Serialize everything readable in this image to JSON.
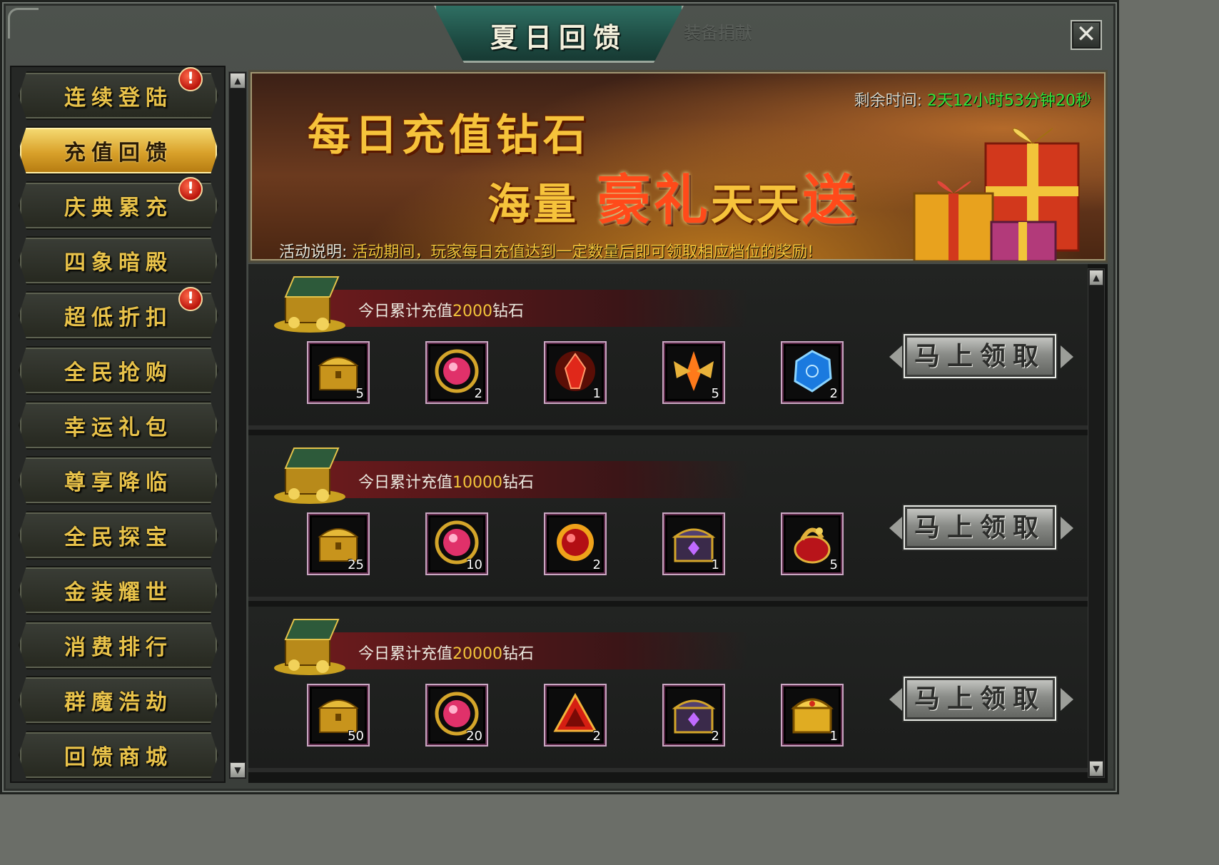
{
  "window": {
    "title": "夏日回馈",
    "inactive_tab": "装备捐献",
    "close_label": "✕"
  },
  "sidebar": {
    "items": [
      {
        "label": "连续登陆",
        "badge": "!"
      },
      {
        "label": "充值回馈",
        "active": true
      },
      {
        "label": "庆典累充",
        "badge": "!"
      },
      {
        "label": "四象暗殿"
      },
      {
        "label": "超低折扣",
        "badge": "!"
      },
      {
        "label": "全民抢购"
      },
      {
        "label": "幸运礼包"
      },
      {
        "label": "尊享降临"
      },
      {
        "label": "全民探宝"
      },
      {
        "label": "金装耀世"
      },
      {
        "label": "消费排行"
      },
      {
        "label": "群魔浩劫"
      },
      {
        "label": "回馈商城"
      }
    ]
  },
  "banner": {
    "timer_label": "剩余时间:",
    "timer_value": "2天12小时53分钟20秒",
    "headline_line1": "每日充值钻石",
    "headline_line2_a": "海量",
    "headline_line2_b": "豪礼",
    "headline_line2_c": "天天",
    "headline_line2_d": "送",
    "desc_label": "活动说明:",
    "desc_text": "活动期间，玩家每日充值达到一定数量后即可领取相应档位的奖励!"
  },
  "rewards": [
    {
      "prefix": "今日累计充值",
      "amount": "2000",
      "suffix": "钻石",
      "claim_label": "马上领取",
      "items": [
        {
          "icon": "gold-chest-icon",
          "qty": "5"
        },
        {
          "icon": "pink-gem-icon",
          "qty": "2"
        },
        {
          "icon": "red-crystal-icon",
          "qty": "1"
        },
        {
          "icon": "flame-wings-icon",
          "qty": "5"
        },
        {
          "icon": "blue-stone-icon",
          "qty": "2"
        }
      ]
    },
    {
      "prefix": "今日累计充值",
      "amount": "10000",
      "suffix": "钻石",
      "claim_label": "马上领取",
      "items": [
        {
          "icon": "gold-chest-icon",
          "qty": "25"
        },
        {
          "icon": "pink-gem-icon",
          "qty": "10"
        },
        {
          "icon": "red-orb-icon",
          "qty": "2"
        },
        {
          "icon": "jewel-chest-icon",
          "qty": "1"
        },
        {
          "icon": "dragon-urn-icon",
          "qty": "5"
        }
      ]
    },
    {
      "prefix": "今日累计充值",
      "amount": "20000",
      "suffix": "钻石",
      "claim_label": "马上领取",
      "items": [
        {
          "icon": "gold-chest-icon",
          "qty": "50"
        },
        {
          "icon": "pink-gem-icon",
          "qty": "20"
        },
        {
          "icon": "red-triangle-icon",
          "qty": "2"
        },
        {
          "icon": "jewel-chest-icon",
          "qty": "2"
        },
        {
          "icon": "golden-chest-icon",
          "qty": "1"
        }
      ]
    }
  ],
  "colors": {
    "gold_text": "#e8c24a",
    "timer_green": "#2fe63a",
    "amount_yellow": "#f2c43a",
    "badge_red": "#b9130b"
  }
}
